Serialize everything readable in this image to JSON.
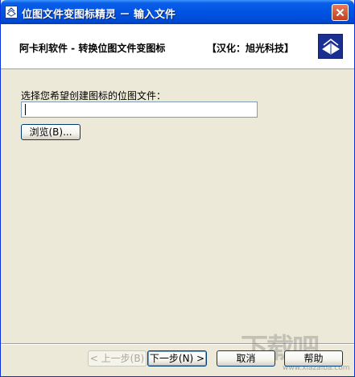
{
  "window": {
    "title": "位图文件变图标精灵 － 输入文件",
    "icon": "app-icon",
    "close_icon": "close-icon"
  },
  "header": {
    "left_text": "阿卡利软件 - 转换位图文件变图标",
    "right_text": "【汉化：旭光科技】",
    "logo_icon": "wizard-logo-icon"
  },
  "form": {
    "prompt": "选择您希望创建图标的位图文件：",
    "file_value": "",
    "browse_label": "浏览(B)..."
  },
  "footer": {
    "back_label": "< 上一步(B)",
    "next_label": "下一步(N) >",
    "cancel_label": "取消",
    "help_label": "帮助"
  },
  "watermark": {
    "text": "下载吧",
    "sub": "www.xiazaiba.com"
  },
  "colors": {
    "titlebar": "#0054e3",
    "dialog_bg": "#ece9d8",
    "header_bg": "#ffffff",
    "logo_bg": "#1a2f8f"
  }
}
